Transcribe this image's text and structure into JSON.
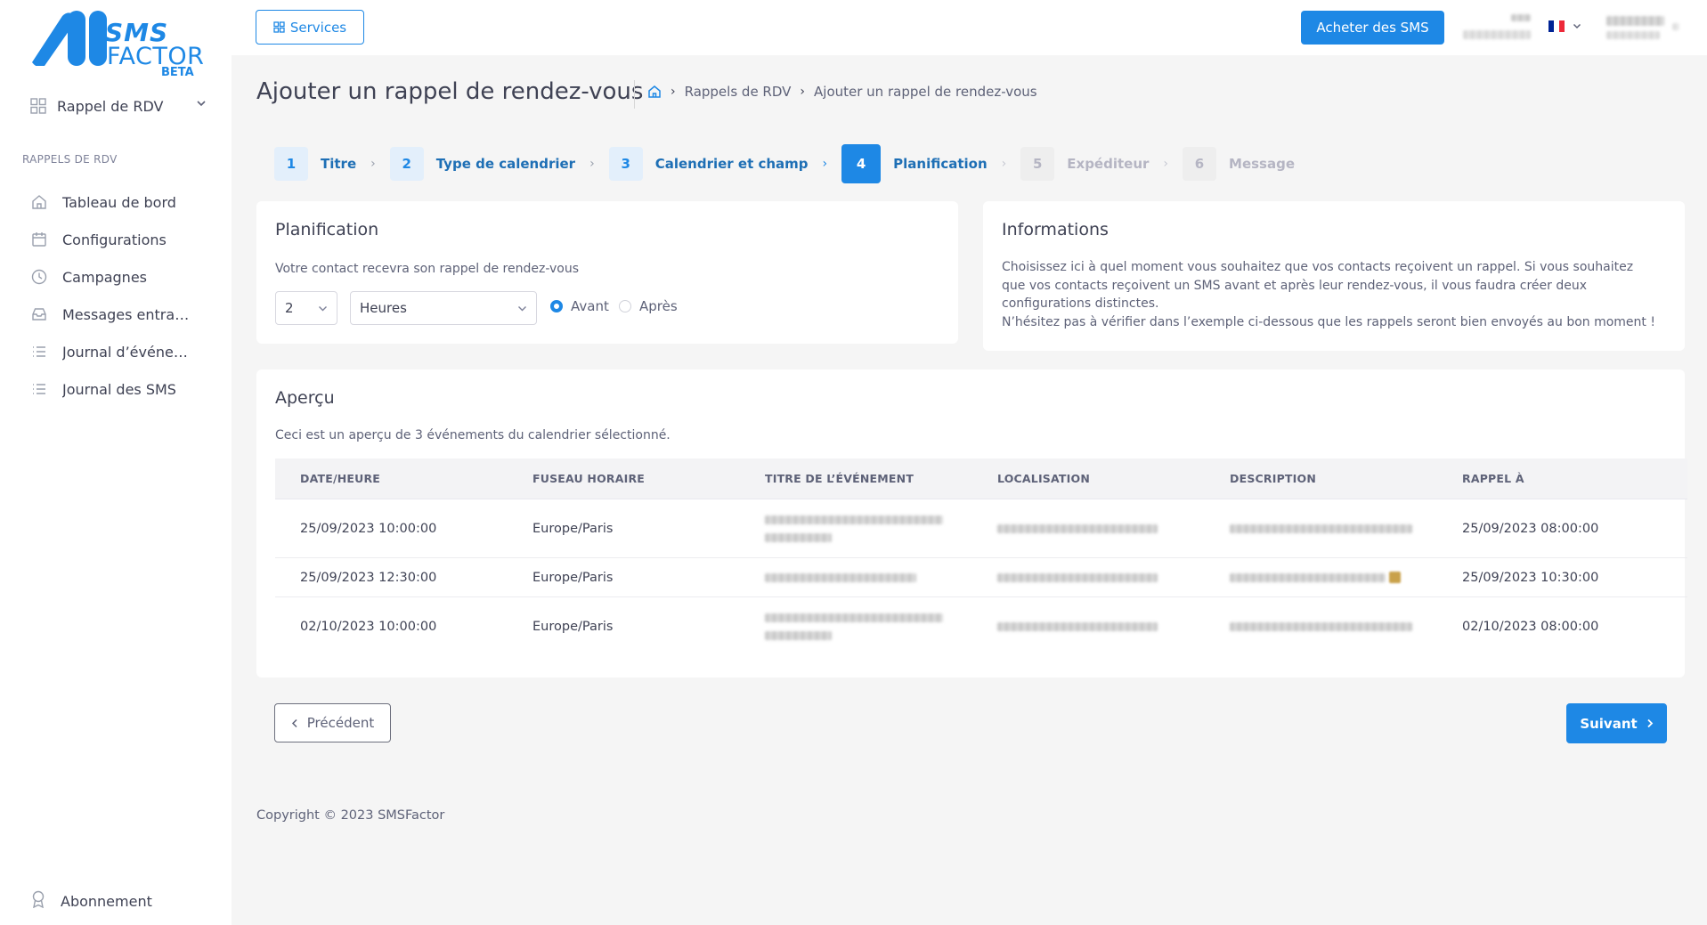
{
  "brand": {
    "line1": "SMS",
    "line2": "FACTOR",
    "badge": "BETA",
    "color": "#1e88e5"
  },
  "sidebar": {
    "module": {
      "label": "Rappel de RDV",
      "icon": "grid-icon"
    },
    "section_title": "RAPPELS DE RDV",
    "items": [
      {
        "label": "Tableau de bord",
        "icon": "home-icon"
      },
      {
        "label": "Configurations",
        "icon": "calendar-icon"
      },
      {
        "label": "Campagnes",
        "icon": "clock-icon"
      },
      {
        "label": "Messages entrants",
        "icon": "inbox-icon"
      },
      {
        "label": "Journal d’événem...",
        "icon": "list-icon"
      },
      {
        "label": "Journal des SMS",
        "icon": "list-icon"
      }
    ],
    "bottom": {
      "label": "Abonnement",
      "icon": "award-icon"
    }
  },
  "topbar": {
    "services_label": "Services",
    "buy_label": "Acheter des SMS",
    "language": "fr"
  },
  "page": {
    "title": "Ajouter un rappel de rendez-vous",
    "breadcrumb": [
      "Rappels de RDV",
      "Ajouter un rappel de rendez-vous"
    ]
  },
  "stepper": [
    {
      "num": "1",
      "label": "Titre",
      "state": "done"
    },
    {
      "num": "2",
      "label": "Type de calendrier",
      "state": "done"
    },
    {
      "num": "3",
      "label": "Calendrier et champ",
      "state": "done"
    },
    {
      "num": "4",
      "label": "Planification",
      "state": "active"
    },
    {
      "num": "5",
      "label": "Expéditeur",
      "state": "todo"
    },
    {
      "num": "6",
      "label": "Message",
      "state": "todo"
    }
  ],
  "planification": {
    "title": "Planification",
    "description": "Votre contact recevra son rappel de rendez-vous",
    "amount": "2",
    "unit": "Heures",
    "option_before": "Avant",
    "option_after": "Après",
    "selected": "Avant"
  },
  "informations": {
    "title": "Informations",
    "line1": "Choisissez ici à quel moment vous souhaitez que vos contacts reçoivent un rappel. Si vous souhaitez que vos contacts reçoivent un SMS avant et après leur rendez-vous, il vous faudra créer deux configurations distinctes.",
    "line2": "N’hésitez pas à vérifier dans l’exemple ci-dessous que les rappels seront bien envoyés au bon moment !"
  },
  "apercu": {
    "title": "Aperçu",
    "description": "Ceci est un aperçu de 3 événements du calendrier sélectionné.",
    "columns": [
      "DATE/HEURE",
      "FUSEAU HORAIRE",
      "TITRE DE L’ÉVÉNEMENT",
      "LOCALISATION",
      "DESCRIPTION",
      "RAPPEL À"
    ],
    "rows": [
      {
        "datetime": "25/09/2023 10:00:00",
        "timezone": "Europe/Paris",
        "reminder": "25/09/2023 08:00:00"
      },
      {
        "datetime": "25/09/2023 12:30:00",
        "timezone": "Europe/Paris",
        "reminder": "25/09/2023 10:30:00"
      },
      {
        "datetime": "02/10/2023 10:00:00",
        "timezone": "Europe/Paris",
        "reminder": "02/10/2023 08:00:00"
      }
    ]
  },
  "nav_buttons": {
    "prev": "Précédent",
    "next": "Suivant"
  },
  "footer": "Copyright © 2023 SMSFactor"
}
